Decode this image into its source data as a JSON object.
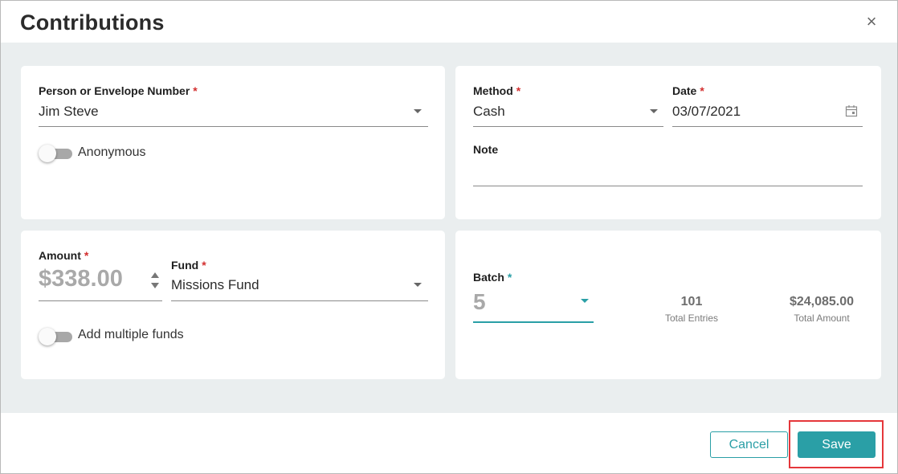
{
  "dialog": {
    "title": "Contributions",
    "close_glyph": "×"
  },
  "person": {
    "label": "Person or Envelope Number",
    "required": "*",
    "value": "Jim Steve"
  },
  "anonymous": {
    "label": "Anonymous",
    "on": false
  },
  "method": {
    "label": "Method",
    "required": "*",
    "value": "Cash"
  },
  "date": {
    "label": "Date",
    "required": "*",
    "value": "03/07/2021",
    "icon": "calendar-icon"
  },
  "note": {
    "label": "Note",
    "value": ""
  },
  "amount": {
    "label": "Amount",
    "required": "*",
    "value": "$338.00"
  },
  "fund": {
    "label": "Fund",
    "required": "*",
    "value": "Missions Fund"
  },
  "multiple_funds": {
    "label": "Add multiple funds",
    "on": false
  },
  "batch": {
    "label": "Batch",
    "required": "*",
    "value": "5",
    "total_entries": "101",
    "total_entries_label": "Total Entries",
    "total_amount": "$24,085.00",
    "total_amount_label": "Total Amount"
  },
  "footer": {
    "cancel_label": "Cancel",
    "save_label": "Save"
  },
  "colors": {
    "accent": "#2a9fa6",
    "required": "#d32f2f",
    "highlight": "#e5373b",
    "body_bg": "#eaeeef"
  }
}
